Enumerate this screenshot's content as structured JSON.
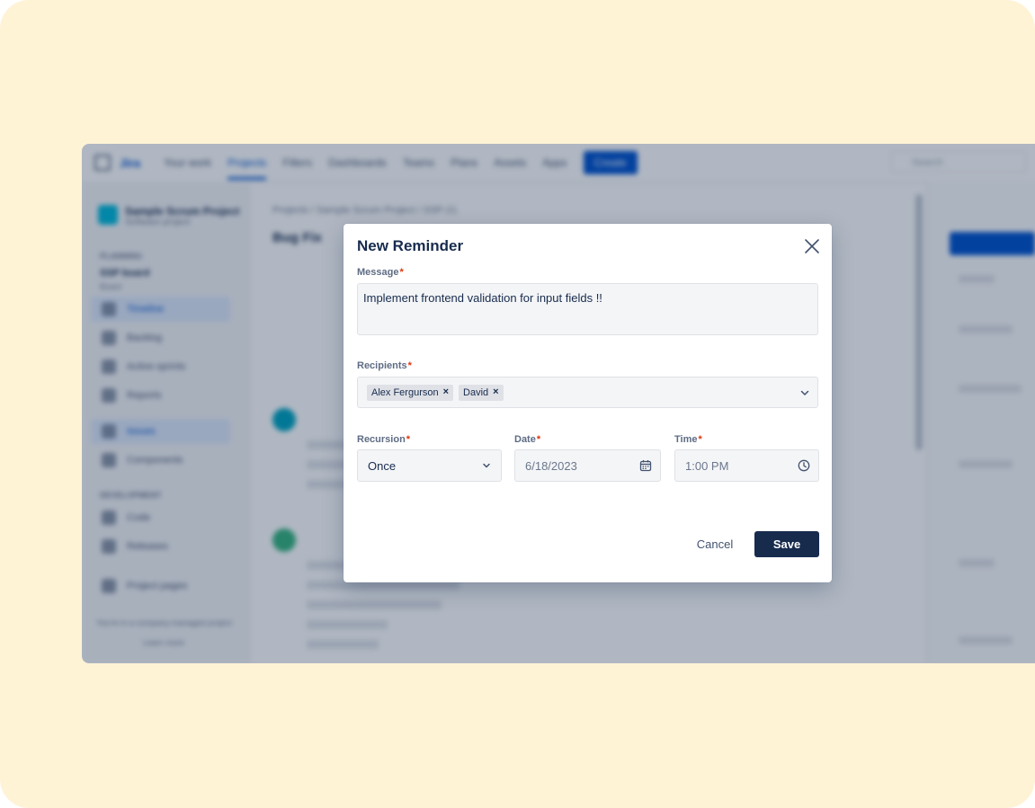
{
  "background_app": {
    "logo": "Jira",
    "nav": [
      "Your work",
      "Projects",
      "Filters",
      "Dashboards",
      "Teams",
      "Plans",
      "Assets",
      "Apps"
    ],
    "create_label": "Create",
    "search_placeholder": "Search",
    "project_name": "Sample Scrum Project",
    "project_type": "Software project",
    "section_planning": "PLANNING",
    "board_name": "SSP board",
    "board_sub": "Board",
    "sidebar_items": [
      "Timeline",
      "Backlog",
      "Active sprints",
      "Reports",
      "Issues",
      "Components"
    ],
    "section_development": "DEVELOPMENT",
    "dev_items": [
      "Code",
      "Releases"
    ],
    "project_pages": "Project pages",
    "footer_text": "You're in a company-managed project",
    "learn_more": "Learn more",
    "breadcrumb": "Projects / Sample Scrum Project / SSP-21",
    "issue_title": "Bug Fix"
  },
  "modal": {
    "title": "New Reminder",
    "message": {
      "label": "Message",
      "required_mark": "*",
      "value": "Implement frontend validation for input fields !!"
    },
    "recipients": {
      "label": "Recipients",
      "required_mark": "*",
      "chips": [
        "Alex Fergurson",
        "David"
      ],
      "chip_remove": "×"
    },
    "recursion": {
      "label": "Recursion",
      "required_mark": "*",
      "value": "Once"
    },
    "date": {
      "label": "Date",
      "required_mark": "*",
      "value": "6/18/2023"
    },
    "time": {
      "label": "Time",
      "required_mark": "*",
      "value": "1:00 PM"
    },
    "cancel_label": "Cancel",
    "save_label": "Save"
  },
  "icons": {
    "close": "close-icon",
    "chevron": "chevron-down-icon",
    "calendar": "calendar-icon",
    "clock": "clock-icon"
  },
  "colors": {
    "page_background": "#fff3d6",
    "primary_button": "#172b4d",
    "required": "#de350b",
    "accent_blue": "#0052cc"
  }
}
